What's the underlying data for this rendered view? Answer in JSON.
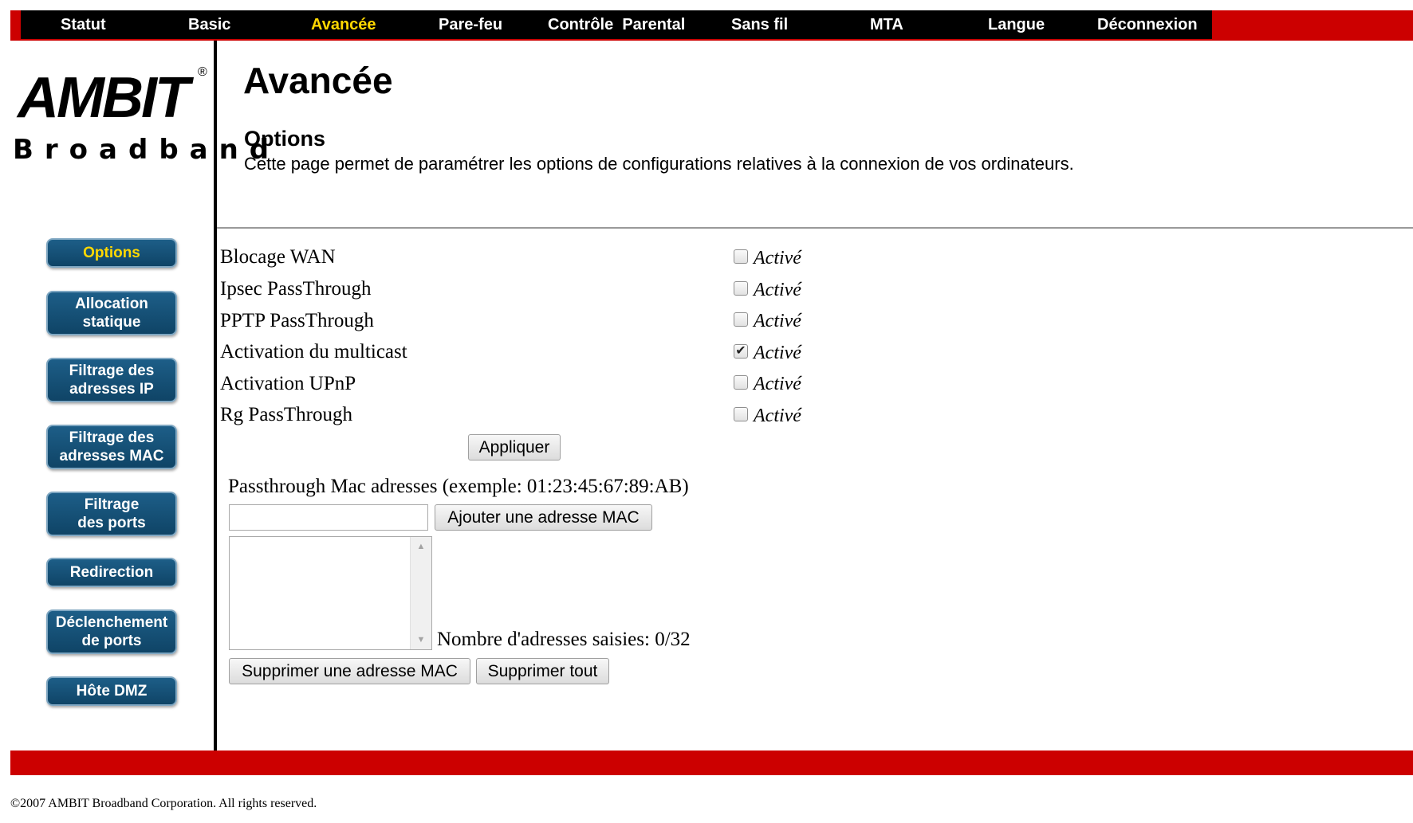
{
  "topnav": {
    "items": [
      {
        "label": "Statut",
        "active": false
      },
      {
        "label": "Basic",
        "active": false
      },
      {
        "label": "Avancée",
        "active": true
      },
      {
        "label": "Pare-feu",
        "active": false
      },
      {
        "label": "Contrôle  Parental",
        "active": false
      },
      {
        "label": "Sans fil",
        "active": false
      },
      {
        "label": "MTA",
        "active": false
      },
      {
        "label": "Langue",
        "active": false
      },
      {
        "label": "Déconnexion",
        "active": false
      }
    ]
  },
  "logo": {
    "main": "AMBIT",
    "sub": "Broadband",
    "mark": "®"
  },
  "sidebar": {
    "items": [
      {
        "label": "Options",
        "active": true
      },
      {
        "label": "Allocation\nstatique",
        "active": false
      },
      {
        "label": "Filtrage des\nadresses IP",
        "active": false
      },
      {
        "label": "Filtrage des\nadresses MAC",
        "active": false
      },
      {
        "label": "Filtrage\ndes ports",
        "active": false
      },
      {
        "label": "Redirection",
        "active": false
      },
      {
        "label": "Déclenchement\nde ports",
        "active": false
      },
      {
        "label": "Hôte DMZ",
        "active": false
      }
    ]
  },
  "page": {
    "title": "Avancée",
    "section_title": "Options",
    "section_desc": "Cette page permet de paramétrer les options de configurations relatives à la connexion de vos ordinateurs."
  },
  "options": {
    "rows": [
      {
        "label": "Blocage WAN",
        "checkbox_label": "Activé",
        "checked": false
      },
      {
        "label": "Ipsec PassThrough",
        "checkbox_label": "Activé",
        "checked": false
      },
      {
        "label": "PPTP PassThrough",
        "checkbox_label": "Activé",
        "checked": false
      },
      {
        "label": "Activation du multicast",
        "checkbox_label": "Activé",
        "checked": true
      },
      {
        "label": "Activation UPnP",
        "checkbox_label": "Activé",
        "checked": false
      },
      {
        "label": "Rg PassThrough",
        "checkbox_label": "Activé",
        "checked": false
      }
    ],
    "apply_label": "Appliquer"
  },
  "mac": {
    "label": "Passthrough Mac adresses (exemple: 01:23:45:67:89:AB)",
    "input_value": "",
    "add_label": "Ajouter une adresse MAC",
    "count_label": "Nombre d'adresses saisies: 0/32",
    "remove_label": "Supprimer une adresse MAC",
    "remove_all_label": "Supprimer tout"
  },
  "footer": {
    "copyright": "©2007 AMBIT Broadband Corporation. All rights reserved."
  },
  "colors": {
    "brand_red": "#cc0000",
    "nav_bg": "#000000",
    "nav_active": "#ffd800",
    "sidebar_button": "#1d5e88"
  }
}
